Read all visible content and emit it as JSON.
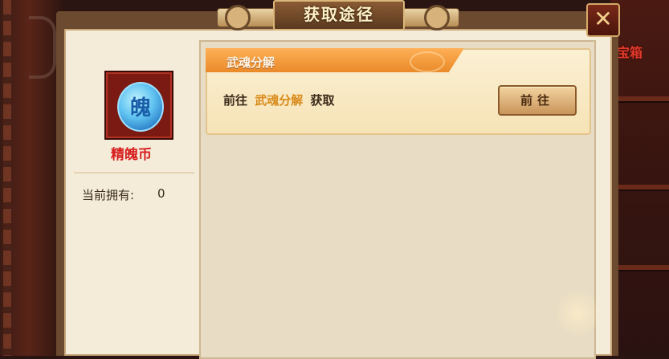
{
  "dialog": {
    "title": "获取途径",
    "close_icon": "close-icon"
  },
  "background": {
    "right_label": "宝箱"
  },
  "item": {
    "name": "精魄币",
    "icon": "spirit-coin-icon",
    "coin_glyph": "魄",
    "own_label": "当前拥有:",
    "own_value": "0"
  },
  "sources": [
    {
      "title": "武魂分解",
      "desc_prefix": "前往",
      "desc_highlight": "武魂分解",
      "desc_suffix": "获取",
      "button_label": "前往"
    }
  ],
  "colors": {
    "item_name": "#d81e1e",
    "card_header": "#e98a2a",
    "highlight": "#d98a1a"
  }
}
